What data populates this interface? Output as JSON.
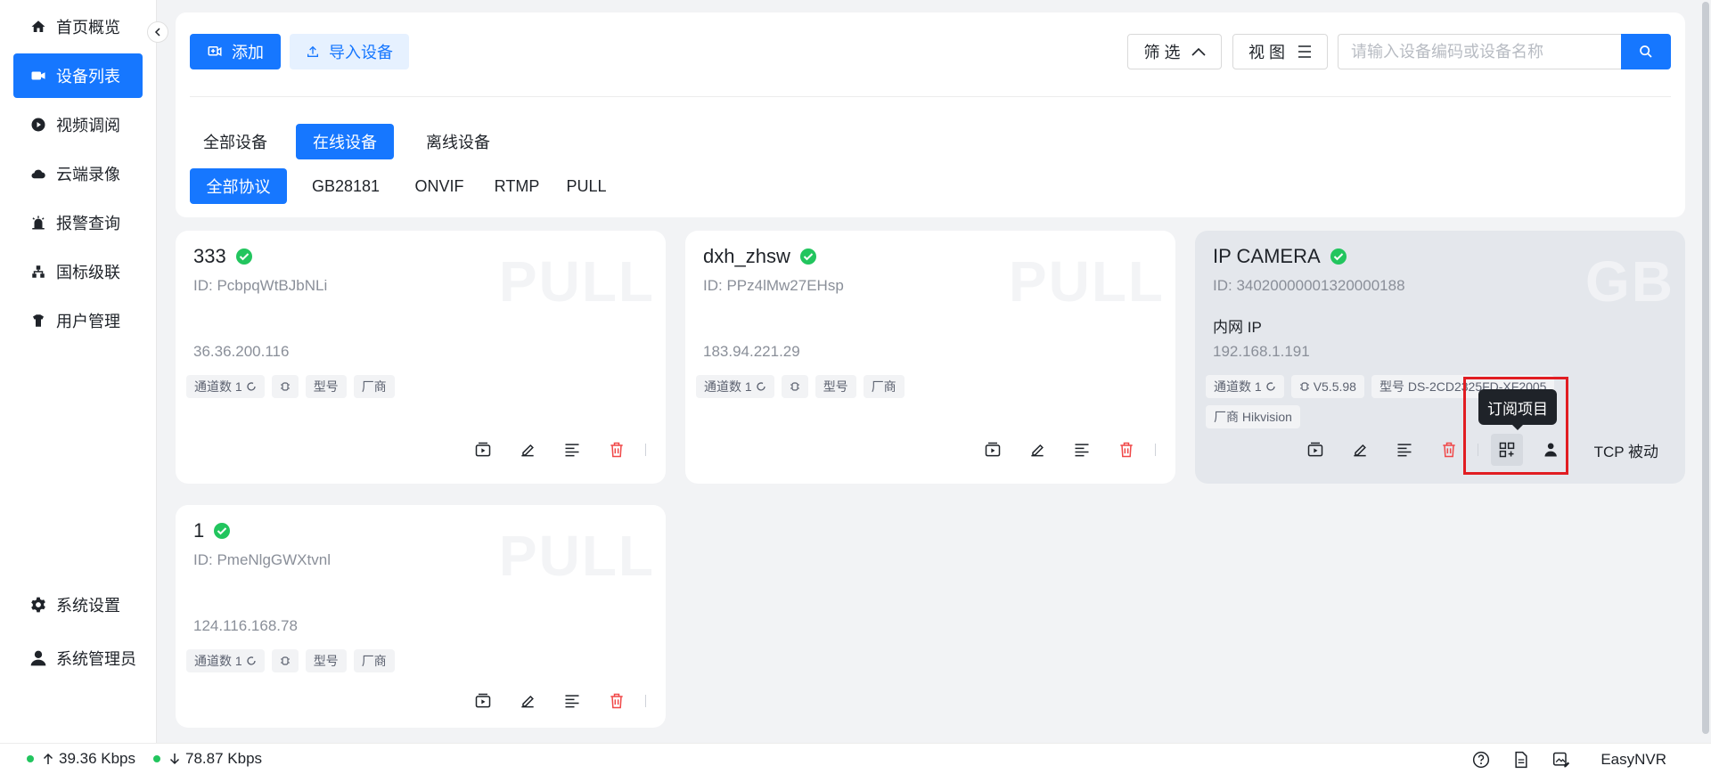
{
  "sidebar": {
    "items": [
      {
        "label": "首页概览",
        "icon": "home-icon"
      },
      {
        "label": "设备列表",
        "icon": "camera-icon",
        "active": true
      },
      {
        "label": "视频调阅",
        "icon": "play-icon"
      },
      {
        "label": "云端录像",
        "icon": "cloud-icon"
      },
      {
        "label": "报警查询",
        "icon": "alarm-icon"
      },
      {
        "label": "国标级联",
        "icon": "cascade-icon"
      },
      {
        "label": "用户管理",
        "icon": "users-icon"
      }
    ],
    "bottom": [
      {
        "label": "系统设置",
        "icon": "gear-icon"
      },
      {
        "label": "系统管理员",
        "icon": "user-icon"
      }
    ]
  },
  "toolbar": {
    "add_label": "添加",
    "import_label": "导入设备",
    "filter_label": "筛 选",
    "view_label": "视 图",
    "search_placeholder": "请输入设备编码或设备名称"
  },
  "status_tabs": [
    "全部设备",
    "在线设备",
    "离线设备"
  ],
  "protocol_tabs": [
    "全部协议",
    "GB28181",
    "ONVIF",
    "RTMP",
    "PULL"
  ],
  "devices": [
    {
      "name": "333",
      "id": "ID: PcbpqWtBJbNLi",
      "ip": "36.36.200.116",
      "watermark": "PULL",
      "tags": [
        "通道数 1",
        "",
        "型号",
        "厂商"
      ]
    },
    {
      "name": "dxh_zhsw",
      "id": "ID: PPz4lMw27EHsp",
      "ip": "183.94.221.29",
      "watermark": "PULL",
      "tags": [
        "通道数 1",
        "",
        "型号",
        "厂商"
      ]
    },
    {
      "name": "IP CAMERA",
      "id": "ID: 34020000001320000188",
      "lan_label": "内网 IP",
      "ip": "192.168.1.191",
      "watermark": "GB",
      "tags": [
        "通道数 1",
        "V5.5.98",
        "型号 DS-2CD2325FD-XF2005",
        "厂商 Hikvision"
      ],
      "transport": "TCP 被动"
    },
    {
      "name": "1",
      "id": "ID: PmeNlgGWXtvnl",
      "ip": "124.116.168.78",
      "watermark": "PULL",
      "tags": [
        "通道数 1",
        "",
        "型号",
        "厂商"
      ]
    }
  ],
  "tooltip": "订阅项目",
  "footer": {
    "upload": "39.36 Kbps",
    "download": "78.87 Kbps",
    "brand": "EasyNVR"
  },
  "colors": {
    "primary": "#1677ff",
    "online": "#22c55e",
    "danger": "#f04747"
  }
}
